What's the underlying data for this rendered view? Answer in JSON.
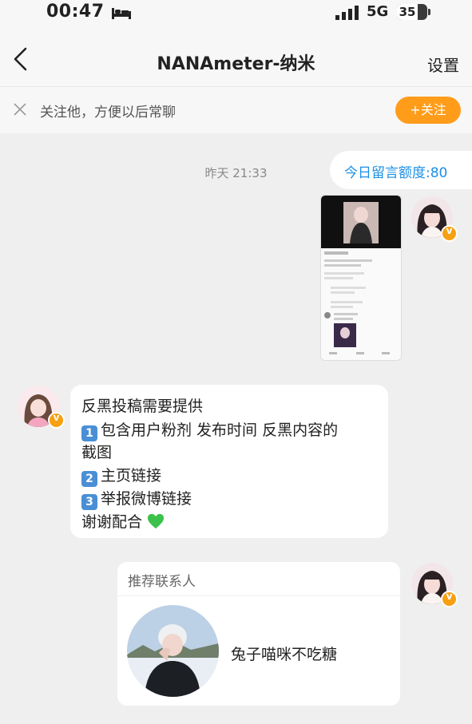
{
  "status_bar": {
    "time": "00:47",
    "network": "5G",
    "battery": "35"
  },
  "nav": {
    "title": "NANAmeter-纳米",
    "settings_label": "设置"
  },
  "follow_banner": {
    "text": "关注他，方便以后常聊",
    "button_label": "+关注"
  },
  "quota_pill": {
    "text": "今日留言额度:80"
  },
  "chat": {
    "timestamp": "昨天 21:33",
    "message": {
      "line1": "反黑投稿需要提供",
      "item1_key": "1",
      "item1_text": "包含用户粉剂 发布时间 反黑内容的",
      "item1_cont": "截图",
      "item2_key": "2",
      "item2_text": "主页链接",
      "item3_key": "3",
      "item3_text": "举报微博链接",
      "thanks": "谢谢配合"
    },
    "card": {
      "title": "推荐联系人",
      "contact_name": "兔子喵咪不吃糖"
    }
  },
  "colors": {
    "accent": "#ff9c1a",
    "link_blue": "#1b8fe6",
    "heart": "#3cc24a"
  }
}
